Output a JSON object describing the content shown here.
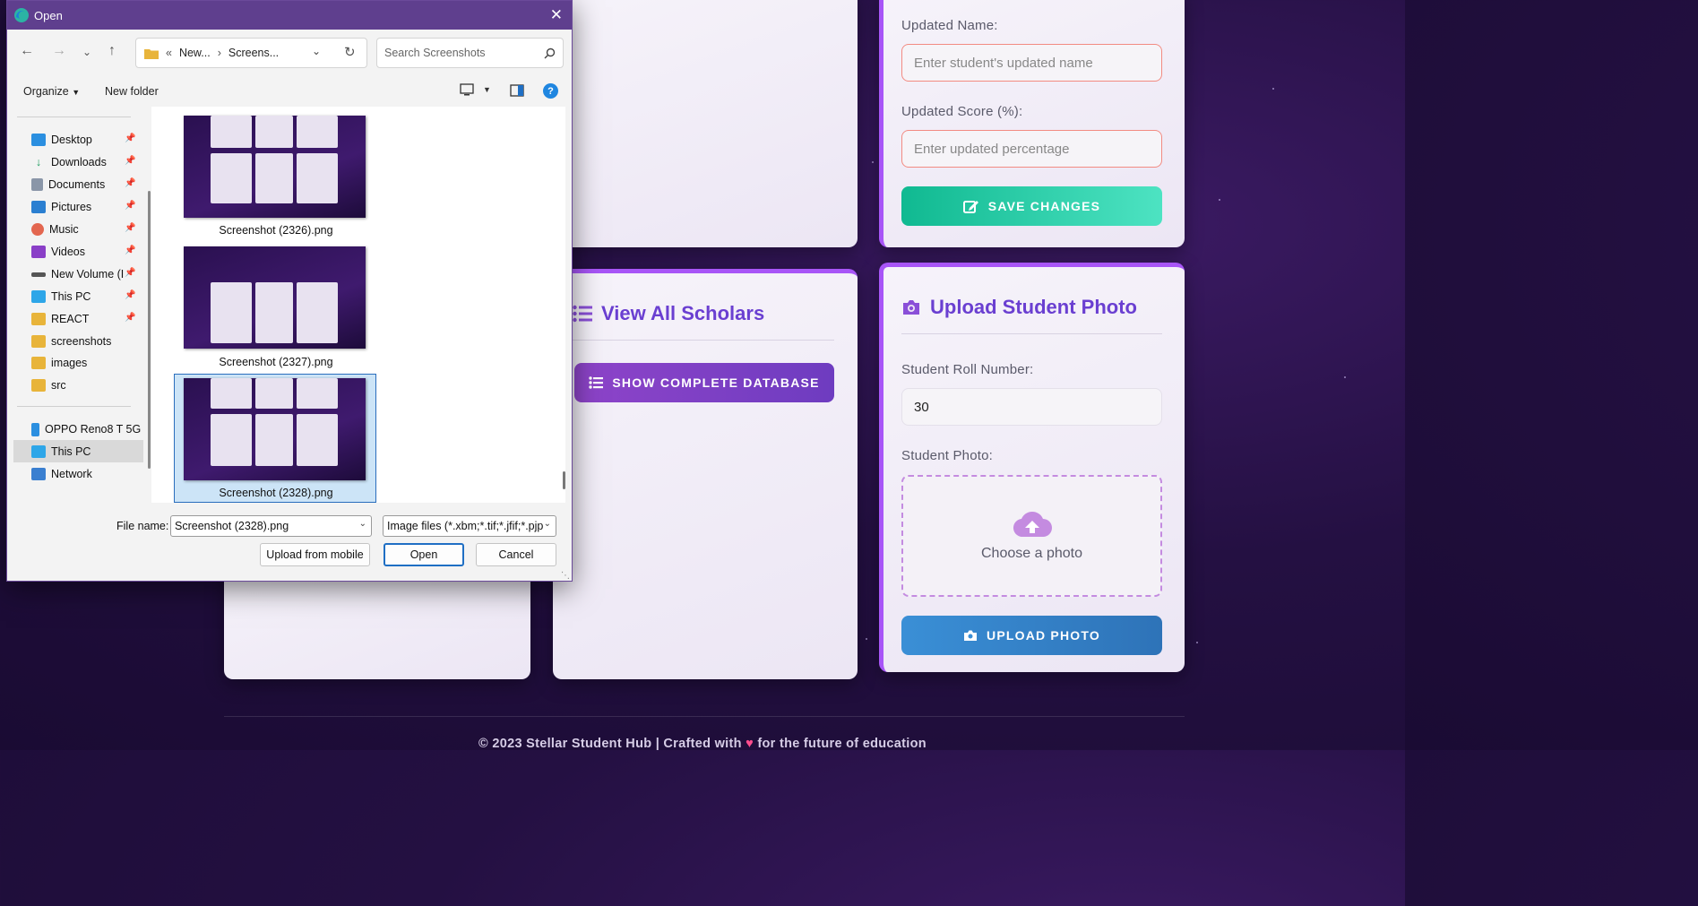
{
  "dialog": {
    "title": "Open",
    "address_prefix": "«",
    "breadcrumb": [
      "New...",
      "Screens..."
    ],
    "search_placeholder": "Search Screenshots",
    "toolbar": {
      "organize_label": "Organize",
      "new_folder_label": "New folder"
    },
    "nav_items": [
      {
        "label": "Desktop",
        "icon": "desktop-icon",
        "pinned": true
      },
      {
        "label": "Downloads",
        "icon": "download-icon",
        "pinned": true
      },
      {
        "label": "Documents",
        "icon": "documents-icon",
        "pinned": true
      },
      {
        "label": "Pictures",
        "icon": "pictures-icon",
        "pinned": true
      },
      {
        "label": "Music",
        "icon": "music-icon",
        "pinned": true
      },
      {
        "label": "Videos",
        "icon": "videos-icon",
        "pinned": true
      },
      {
        "label": "New Volume (I",
        "icon": "drive-icon",
        "pinned": true
      },
      {
        "label": "This PC",
        "icon": "pc-icon",
        "pinned": true
      },
      {
        "label": "REACT",
        "icon": "folder-icon",
        "pinned": true
      },
      {
        "label": "screenshots",
        "icon": "folder-icon",
        "pinned": false
      },
      {
        "label": "images",
        "icon": "folder-icon",
        "pinned": false
      },
      {
        "label": "src",
        "icon": "folder-icon",
        "pinned": false
      }
    ],
    "devices": [
      {
        "label": "OPPO Reno8 T 5G",
        "icon": "phone-icon"
      },
      {
        "label": "This PC",
        "icon": "pc-icon",
        "selected": true
      },
      {
        "label": "Network",
        "icon": "network-icon"
      }
    ],
    "files": [
      {
        "name": "Screenshot (2326).png",
        "selected": false
      },
      {
        "name": "Screenshot (2327).png",
        "selected": false
      },
      {
        "name": "Screenshot (2328).png",
        "selected": true
      }
    ],
    "file_name_label": "File name:",
    "file_name_value": "Screenshot (2328).png",
    "file_type_value": "Image files (*.xbm;*.tif;*.jfif;*.pjp",
    "upload_mobile_label": "Upload from mobile",
    "open_label": "Open",
    "cancel_label": "Cancel"
  },
  "page": {
    "edit_card": {
      "updated_name_label": "Updated Name:",
      "updated_name_placeholder": "Enter student's updated name",
      "updated_score_label": "Updated Score (%):",
      "updated_score_placeholder": "Enter updated percentage",
      "save_label": "SAVE CHANGES"
    },
    "view_card": {
      "title": "View All Scholars",
      "button_label": "SHOW COMPLETE DATABASE"
    },
    "upload_card": {
      "title": "Upload Student Photo",
      "roll_label": "Student Roll Number:",
      "roll_value": "30",
      "photo_label": "Student Photo:",
      "dropzone_text": "Choose a photo",
      "button_label": "UPLOAD PHOTO"
    },
    "footer": {
      "text_before": "© 2023 Stellar Student Hub | Crafted with",
      "text_after": "for the future of education"
    }
  },
  "colors": {
    "accent": "#a855f7",
    "title": "#6a3fd1",
    "save": "#10b991",
    "upload": "#3a8fd6",
    "dialog_title": "#5f3f8e"
  }
}
